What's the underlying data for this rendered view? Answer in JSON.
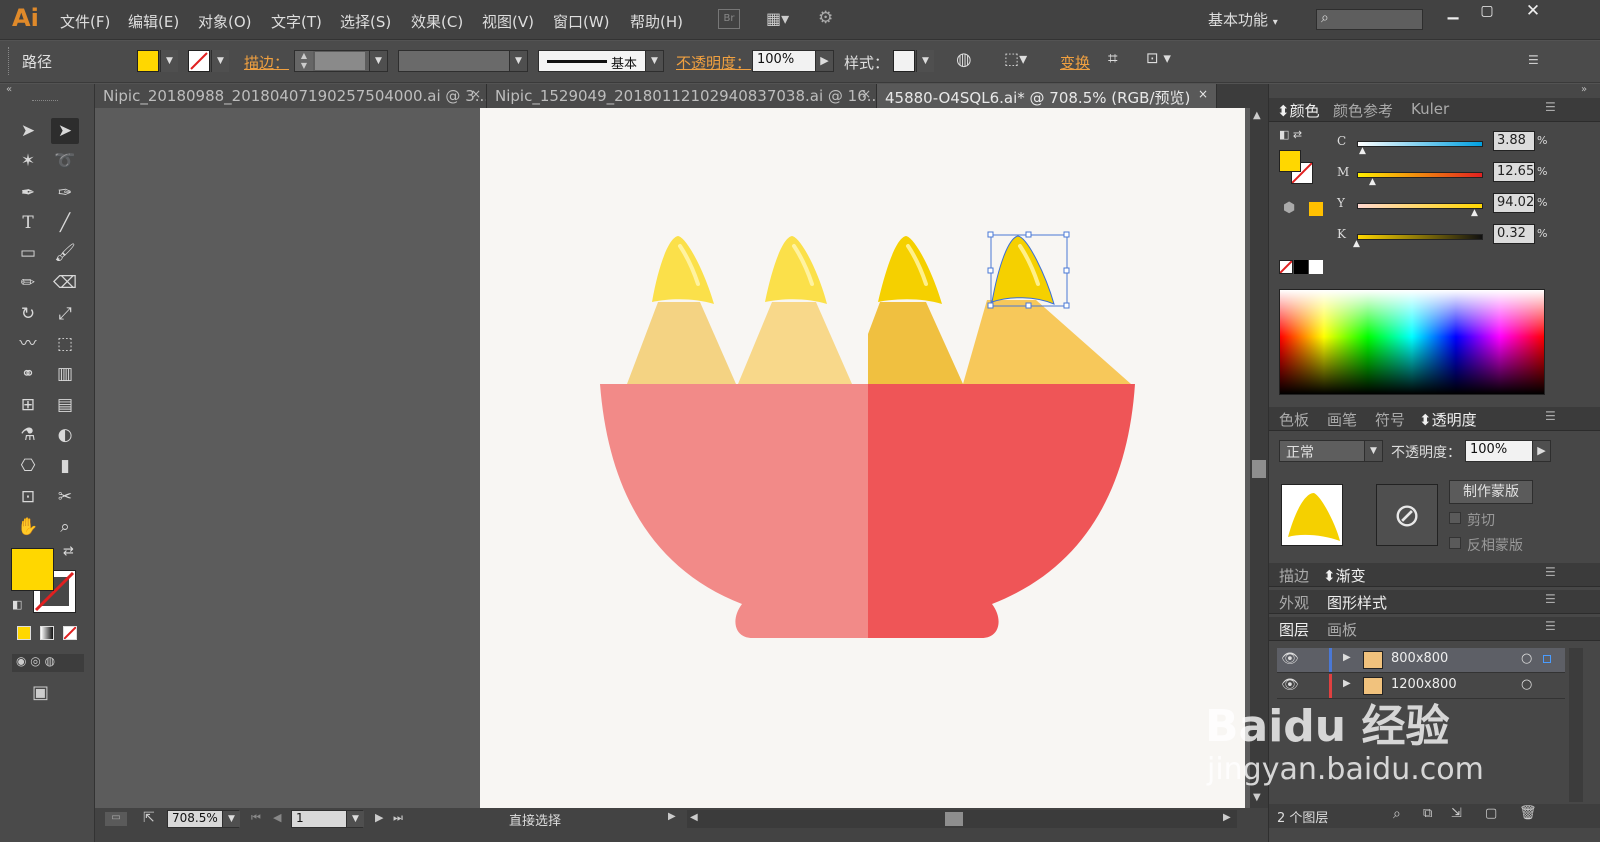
{
  "app": {
    "logo": "Ai"
  },
  "menu": [
    "文件(F)",
    "编辑(E)",
    "对象(O)",
    "文字(T)",
    "选择(S)",
    "效果(C)",
    "视图(V)",
    "窗口(W)",
    "帮助(H)"
  ],
  "top_right": {
    "workspace": "基本功能",
    "search_placeholder": ""
  },
  "control_bar": {
    "selection_type": "路径",
    "stroke_label": "描边：",
    "stroke_profile": "基本",
    "opacity_label": "不透明度：",
    "opacity_value": "100%",
    "style_label": "样式：",
    "transform_label": "变换",
    "fill_color": "#ffd700"
  },
  "tabs": [
    {
      "label": "Nipic_20180988_20180407190257504000.ai @ 3...",
      "active": false
    },
    {
      "label": "Nipic_1529049_20180112102940837038.ai @ 16...",
      "active": false
    },
    {
      "label": "45880-O4SQL6.ai* @ 708.5% (RGB/预览)",
      "active": true
    }
  ],
  "status": {
    "zoom": "708.5%",
    "page": "1",
    "tool_name": "直接选择"
  },
  "color_panel": {
    "tabs": [
      "颜色",
      "颜色参考",
      "Kuler"
    ],
    "channels": [
      {
        "name": "C",
        "value": "3.88",
        "fraction": 0.04
      },
      {
        "name": "M",
        "value": "12.65",
        "fraction": 0.13
      },
      {
        "name": "Y",
        "value": "94.02",
        "fraction": 0.94
      },
      {
        "name": "K",
        "value": "0.32",
        "fraction": 0.0
      }
    ]
  },
  "transparency_panel": {
    "tabs": [
      "色板",
      "画笔",
      "符号",
      "透明度"
    ],
    "blend_mode": "正常",
    "opacity_label": "不透明度：",
    "opacity_value": "100%",
    "make_mask": "制作蒙版",
    "clip": "剪切",
    "invert_mask": "反相蒙版"
  },
  "stroke_panel": {
    "tabs": [
      "描边",
      "渐变"
    ]
  },
  "appearance_panel": {
    "tabs": [
      "外观",
      "图形样式"
    ]
  },
  "layers_panel": {
    "tabs": [
      "图层",
      "画板"
    ],
    "layers": [
      {
        "name": "800x800"
      },
      {
        "name": "1200x800"
      }
    ],
    "count": "2 个图层"
  },
  "watermark": {
    "brand": "Baidu 经验",
    "url": "jingyan.baidu.com"
  },
  "colors": {
    "bowl_left": "#f28a88",
    "bowl_right": "#ef5557",
    "tip_yellow": "#ffe033",
    "body_light": "#f4d383",
    "body_mid": "#f8d88a",
    "body_dark": "#f0c040"
  }
}
